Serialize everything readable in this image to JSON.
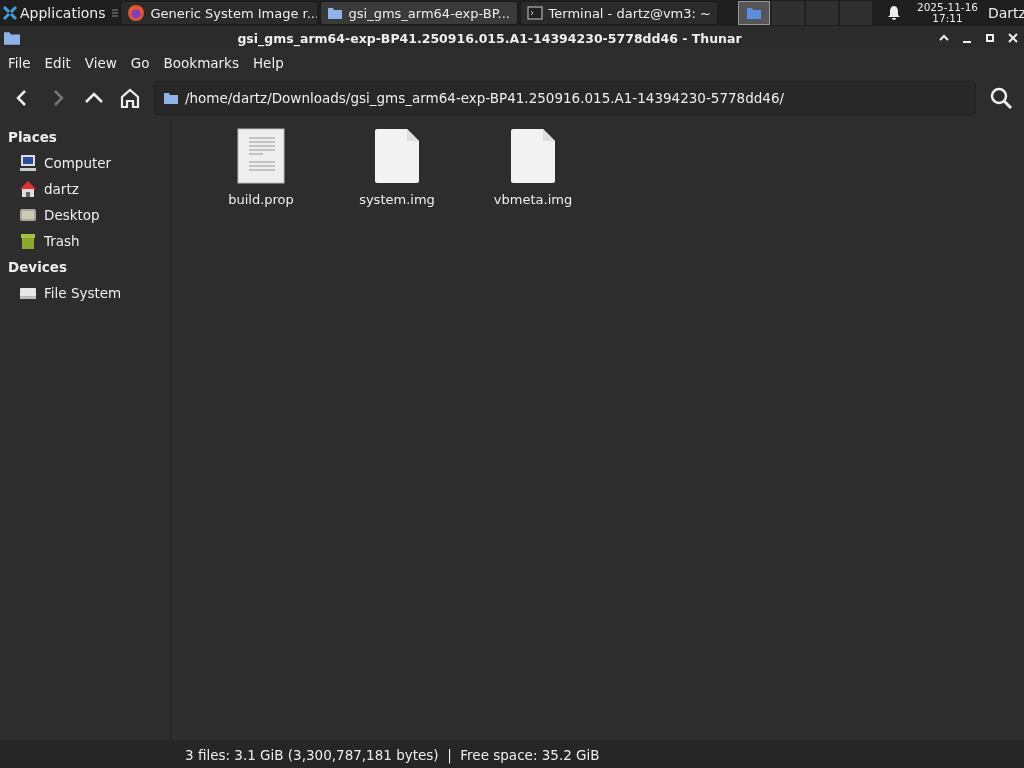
{
  "taskbar": {
    "apps_label": "Applications",
    "tasks": [
      {
        "label": "Generic System Image r...",
        "kind": "browser",
        "selected": false
      },
      {
        "label": "gsi_gms_arm64-exp-BP...",
        "kind": "folder",
        "selected": true
      },
      {
        "label": "Terminal - dartz@vm3: ~",
        "kind": "terminal",
        "selected": false
      }
    ],
    "workspaces": [
      {
        "selected": true
      },
      {
        "selected": false
      },
      {
        "selected": false
      },
      {
        "selected": false
      }
    ],
    "date": "2025-11-16",
    "time": "17:11",
    "user": "Dartz"
  },
  "window": {
    "title": "gsi_gms_arm64-exp-BP41.250916.015.A1-14394230-5778dd46 - Thunar"
  },
  "menu": [
    "File",
    "Edit",
    "View",
    "Go",
    "Bookmarks",
    "Help"
  ],
  "location": "/home/dartz/Downloads/gsi_gms_arm64-exp-BP41.250916.015.A1-14394230-5778dd46/",
  "sidebar": [
    {
      "heading": "Places",
      "items": [
        {
          "label": "Computer",
          "kind": "computer"
        },
        {
          "label": "dartz",
          "kind": "home"
        },
        {
          "label": "Desktop",
          "kind": "desktop"
        },
        {
          "label": "Trash",
          "kind": "trash"
        }
      ]
    },
    {
      "heading": "Devices",
      "items": [
        {
          "label": "File System",
          "kind": "drive"
        }
      ]
    }
  ],
  "files": [
    {
      "name": "build.prop",
      "kind": "text"
    },
    {
      "name": "system.img",
      "kind": "blank"
    },
    {
      "name": "vbmeta.img",
      "kind": "blank"
    }
  ],
  "status_bar": "3 files: 3.1 GiB (3,300,787,181 bytes)  |  Free space: 35.2 GiB"
}
